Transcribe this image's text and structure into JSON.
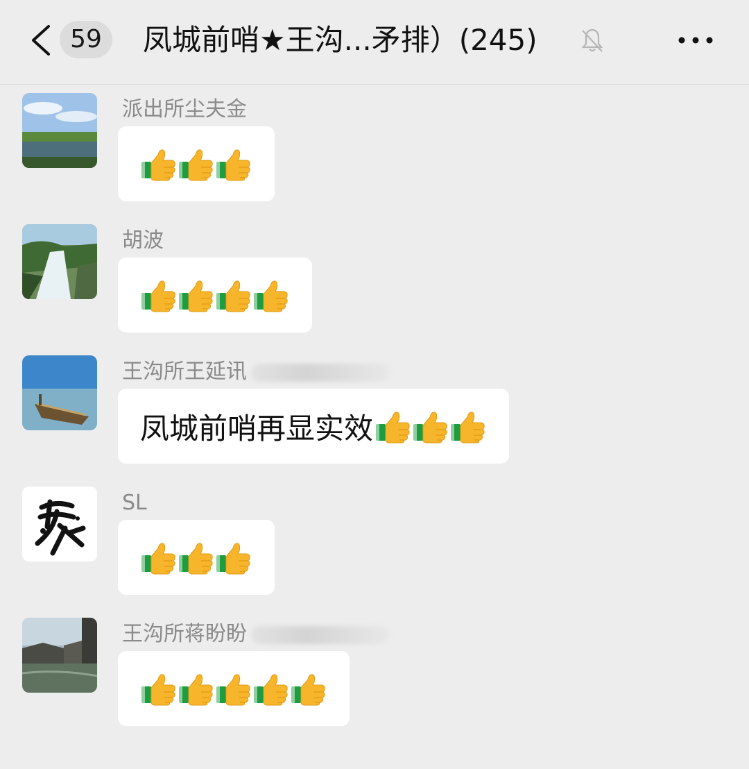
{
  "header": {
    "back_icon": "chevron-left-icon",
    "unread_count": "59",
    "title": "凤城前哨★王沟...矛排）(245)",
    "mute_icon": "bell-muted-icon",
    "more_icon": "more-dots-icon"
  },
  "messages": [
    {
      "sender": "派出所尘夫金",
      "text": "",
      "thumbs": 3,
      "avatar": "landscape-lake-avatar"
    },
    {
      "sender": "胡波",
      "text": "",
      "thumbs": 4,
      "avatar": "waterfall-avatar"
    },
    {
      "sender": "王沟所王延讯",
      "text": "凤城前哨再显实效",
      "thumbs": 3,
      "avatar": "boat-on-lake-avatar",
      "sender_blurred": true
    },
    {
      "sender": "SL",
      "text": "",
      "thumbs": 3,
      "avatar": "calligraphy-avatar"
    },
    {
      "sender": "王沟所蒋盼盼",
      "text": "",
      "thumbs": 5,
      "avatar": "water-town-avatar",
      "sender_blurred": true
    }
  ],
  "colors": {
    "background": "#ededed",
    "bubble": "#ffffff",
    "sender_text": "#8a8a8a",
    "thumb_yellow": "#f7b52b",
    "thumb_cuff": "#1d9d3f"
  }
}
